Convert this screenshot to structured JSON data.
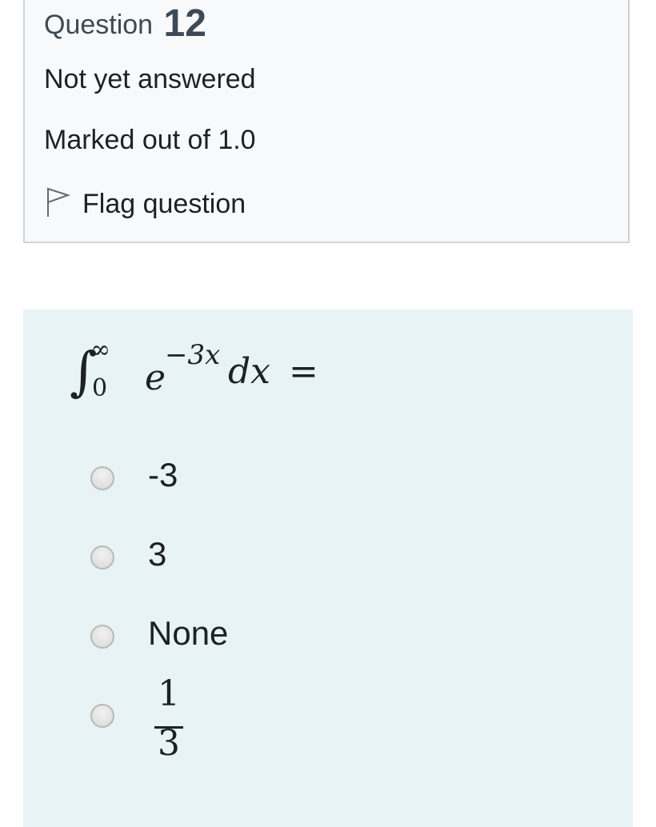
{
  "info": {
    "question_label": "Question",
    "question_number": "12",
    "state": "Not yet answered",
    "grade": "Marked out of 1.0",
    "flag_label": "Flag question",
    "flag_icon": "flag-outline-icon"
  },
  "question": {
    "formula": {
      "integral_sign": "∫",
      "upper_limit": "∞",
      "lower_limit": "0",
      "base": "e",
      "exponent": "−3x",
      "differential": "dx",
      "equals": "="
    }
  },
  "answers": [
    {
      "label": "-3",
      "selected": false
    },
    {
      "label": "3",
      "selected": false
    },
    {
      "label": "None",
      "selected": false
    },
    {
      "numerator": "1",
      "denominator": "3",
      "selected": false
    }
  ],
  "colors": {
    "info_background": "#f8f9fa",
    "info_border": "#ced4da",
    "formulation_background": "#e7f3f5",
    "question_number_color": "#3d4a55",
    "text": "#1d2125"
  }
}
